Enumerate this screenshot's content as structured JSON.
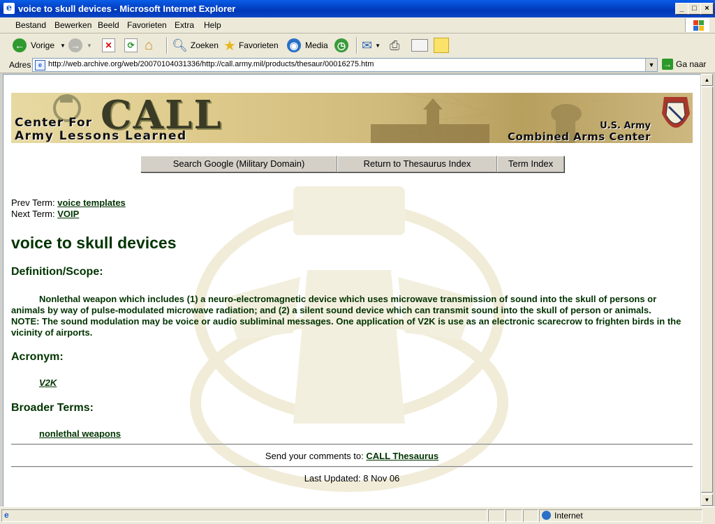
{
  "window": {
    "title": "voice to skull devices - Microsoft Internet Explorer",
    "controls": [
      "_",
      "□",
      "×"
    ]
  },
  "menu": [
    "Bestand",
    "Bewerken",
    "Beeld",
    "Favorieten",
    "Extra",
    "Help"
  ],
  "toolbar": {
    "back": "Vorige",
    "search": "Zoeken",
    "favorites": "Favorieten",
    "media": "Media"
  },
  "address": {
    "label": "Adres",
    "url": "http://web.archive.org/web/20070104031336/http://call.army.mil/products/thesaur/00016275.htm",
    "go": "Ga naar"
  },
  "banner": {
    "call": "CALL",
    "line1": "Center For",
    "line2": "Army Lessons Learned",
    "right1": "U.S. Army",
    "right2": "Combined Arms Center"
  },
  "buttons": {
    "search_google": "Search Google (Military Domain)",
    "return_index": "Return to Thesaurus Index",
    "term_index": "Term Index"
  },
  "nav": {
    "prev_label": "Prev Term:",
    "prev_term": "voice templates",
    "next_label": "Next Term:",
    "next_term": "VOIP"
  },
  "term": {
    "title": "voice to skull devices",
    "definition_heading": "Definition/Scope:",
    "definition": "Nonlethal weapon which includes (1) a neuro-electromagnetic device which uses microwave transmission of sound into the skull of persons or animals by way of pulse-modulated microwave radiation; and (2) a silent sound device which can transmit sound into the skull of person or animals. NOTE: The sound modulation may be voice or audio subliminal messages. One application of V2K is use as an electronic scarecrow to frighten birds in the vicinity of airports.",
    "acronym_heading": "Acronym:",
    "acronym": "V2K",
    "broader_heading": "Broader Terms:",
    "broader": "nonlethal weapons"
  },
  "footer": {
    "comments_label": "Send your comments to:",
    "comments_link": "CALL Thesaurus",
    "updated": "Last Updated: 8 Nov 06"
  },
  "status": {
    "zone": "Internet"
  }
}
